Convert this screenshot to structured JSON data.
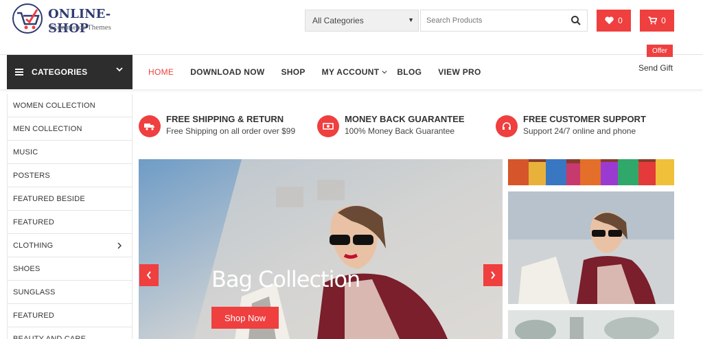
{
  "header": {
    "logo_title": "ONLINE-SHOP",
    "logo_subtitle": "Ecommerce Themes",
    "category_select": "All Categories",
    "search_placeholder": "Search Products",
    "wishlist_count": "0",
    "cart_count": "0"
  },
  "nav": {
    "categories_label": "CATEGORIES",
    "items": [
      "HOME",
      "DOWNLOAD NOW",
      "SHOP",
      "MY ACCOUNT",
      "BLOG",
      "VIEW PRO"
    ],
    "offer_badge": "Offer",
    "send_gift": "Send Gift"
  },
  "sidebar": {
    "items": [
      "WOMEN COLLECTION",
      "MEN COLLECTION",
      "MUSIC",
      "POSTERS",
      "FEATURED BESIDE",
      "FEATURED",
      "CLOTHING",
      "SHOES",
      "SUNGLASS",
      "FEATURED",
      "BEAUTY AND CARE"
    ]
  },
  "features": [
    {
      "title": "FREE SHIPPING & RETURN",
      "subtitle": "Free Shipping on all order over $99",
      "icon": "truck-icon"
    },
    {
      "title": "MONEY BACK GUARANTEE",
      "subtitle": "100% Money Back Guarantee",
      "icon": "money-icon"
    },
    {
      "title": "FREE CUSTOMER SUPPORT",
      "subtitle": "Support 24/7 online and phone",
      "icon": "headset-icon"
    }
  ],
  "slider": {
    "title": "Bag Collection",
    "button": "Shop Now"
  },
  "colors": {
    "accent": "#ef3f3f",
    "dark": "#2d2d2d",
    "brand": "#2e3b72"
  }
}
